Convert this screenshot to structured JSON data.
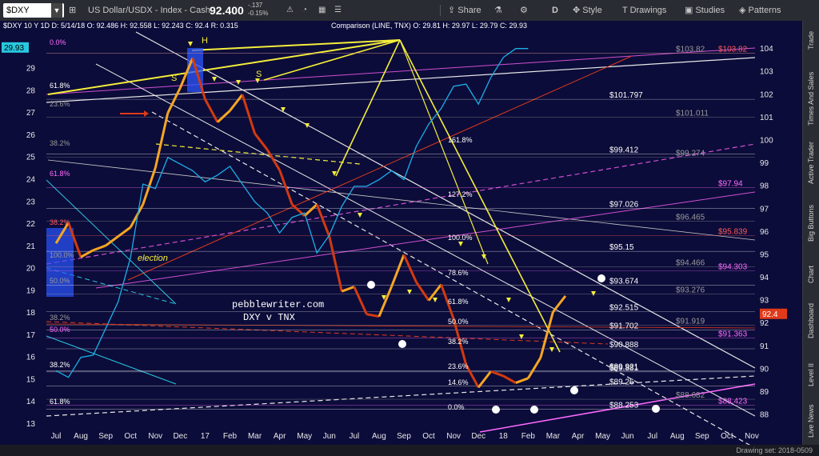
{
  "toolbar": {
    "symbol": "$DXY",
    "title": "US Dollar/USDX - Index - Cash",
    "last_price": "92.400",
    "change": "-.137",
    "change_pct": "-0.15%",
    "share": "Share",
    "interval": "D",
    "style": "Style",
    "drawings": "Drawings",
    "studies": "Studies",
    "patterns": "Patterns"
  },
  "legend": {
    "main": "$DXY 10 Y 1D  D: 5/14/18  O: 92.486  H: 92.558  L: 92.243  C: 92.4  R: 0.315",
    "comparison": "Comparison (LINE, TNX)  O: 29.81  H: 29.97  L: 29.79  C: 29.93"
  },
  "sidebar": [
    "Trade",
    "Times And Sales",
    "Active Trader",
    "Big Buttons",
    "Chart",
    "Dashboard",
    "Level II",
    "Live News"
  ],
  "status": "Drawing set: 2018-0509",
  "colors": {
    "bg": "#0c0c3a",
    "price_up": "#f5a623",
    "price_dn": "#d23a10",
    "tnx": "#1ab0e8",
    "yellow": "#f4ee3a",
    "magenta": "#d050d0",
    "white": "#e8e8e8",
    "red": "#e03a1a",
    "cyan": "#28c8e0"
  },
  "chart_data": {
    "type": "line",
    "title": "DXY v TNX",
    "watermark": "pebblewriter.com",
    "xlabels": [
      "Jul",
      "Aug",
      "Sep",
      "Oct",
      "Nov",
      "Dec",
      "17",
      "Feb",
      "Mar",
      "Apr",
      "May",
      "Jun",
      "Jul",
      "Aug",
      "Sep",
      "Oct",
      "Nov",
      "Dec",
      "18",
      "Feb",
      "Mar",
      "Apr",
      "May",
      "Jun",
      "Jul",
      "Aug",
      "Sep",
      "Oct",
      "Nov"
    ],
    "right_axis": {
      "label": "DXY",
      "min": 87.6,
      "max": 104.6,
      "ticks": [
        88,
        89,
        90,
        91,
        92,
        93,
        94,
        95,
        96,
        97,
        98,
        99,
        100,
        101,
        102,
        103,
        104
      ],
      "current": "92.4"
    },
    "left_axis": {
      "label": "TNX",
      "min": 13,
      "max": 30.5,
      "ticks": [
        13,
        14,
        15,
        16,
        17,
        18,
        19,
        20,
        21,
        22,
        23,
        24,
        25,
        26,
        27,
        28,
        29
      ],
      "current": "29.93"
    },
    "series": [
      {
        "name": "$DXY",
        "x": [
          0,
          0.5,
          1,
          1.5,
          2,
          2.5,
          3,
          3.5,
          4,
          4.5,
          5,
          5.5,
          6,
          6.5,
          7,
          7.5,
          8,
          8.5,
          9,
          9.5,
          10,
          10.5,
          11,
          11.5,
          12,
          12.5,
          13,
          13.5,
          14,
          14.5,
          15,
          15.5,
          16,
          16.5,
          17,
          17.5,
          18,
          18.5,
          19,
          19.5,
          20,
          20.5,
          21,
          21.5,
          22,
          22.5
        ],
        "values": [
          95.5,
          96.4,
          94.9,
          95.2,
          95.4,
          95.8,
          96.2,
          97.2,
          98.8,
          101.2,
          102.3,
          103.6,
          101.8,
          100.8,
          101.3,
          102.0,
          100.3,
          99.6,
          98.7,
          97.2,
          96.7,
          97.2,
          95.8,
          93.4,
          93.6,
          92.4,
          92.3,
          93.6,
          95.0,
          93.8,
          93.0,
          93.7,
          92.2,
          90.2,
          89.2,
          89.9,
          89.7,
          89.4,
          89.6,
          90.5,
          92.5,
          93.2,
          null,
          null,
          null,
          null
        ]
      },
      {
        "name": "TNX",
        "x": [
          0,
          0.5,
          1,
          1.5,
          2,
          2.5,
          3,
          3.5,
          4,
          4.5,
          5,
          5.5,
          6,
          6.5,
          7,
          7.5,
          8,
          8.5,
          9,
          9.5,
          10,
          10.5,
          11,
          11.5,
          12,
          12.5,
          13,
          13.5,
          14,
          14.5,
          15,
          15.5,
          16,
          16.5,
          17,
          17.5,
          18,
          18.5,
          19,
          19.5,
          20,
          20.5,
          21,
          21.5
        ],
        "values": [
          15.4,
          15.1,
          16.0,
          16.1,
          17.3,
          18.5,
          20.5,
          23.8,
          23.6,
          25.0,
          24.7,
          24.4,
          23.9,
          24.2,
          24.6,
          23.8,
          23.0,
          22.5,
          21.6,
          22.3,
          22.5,
          20.7,
          21.5,
          22.8,
          23.7,
          23.7,
          24.0,
          24.4,
          24.0,
          25.5,
          26.5,
          27.2,
          28.2,
          28.3,
          27.4,
          28.6,
          29.5,
          29.9,
          29.9,
          null,
          null,
          null,
          null,
          null
        ]
      }
    ],
    "annotations": [
      "H",
      "S",
      "S",
      "election",
      "0.0%",
      "61.8%",
      "23.6%",
      "38.2%",
      "61.8%",
      "50.0%",
      "38.2%",
      "50.0%",
      "38.2%",
      "100.0%",
      "38.2%",
      "61.8%",
      "161.8%",
      "127.2%",
      "100.0%",
      "78.6%",
      "61.8%",
      "50.0%",
      "38.2%",
      "23.6%",
      "14.6%",
      "0.0%"
    ],
    "price_levels": [
      {
        "value": 103.82,
        "label": "$103.82",
        "color": "#ff5a5a"
      },
      {
        "value": 103.82,
        "label": "$103.82",
        "color": "#9a9a9a"
      },
      {
        "value": 101.797,
        "label": "$101.797",
        "color": "#ffffff"
      },
      {
        "value": 101.011,
        "label": "$101.011",
        "color": "#9a9a9a"
      },
      {
        "value": 99.412,
        "label": "$99.412",
        "color": "#ffffff"
      },
      {
        "value": 99.274,
        "label": "$99.274",
        "color": "#9a9a9a"
      },
      {
        "value": 97.94,
        "label": "$97.94",
        "color": "#ff6aff"
      },
      {
        "value": 97.026,
        "label": "$97.026",
        "color": "#ffffff"
      },
      {
        "value": 96.465,
        "label": "$96.465",
        "color": "#9a9a9a"
      },
      {
        "value": 95.839,
        "label": "$95.839",
        "color": "#ff5a5a"
      },
      {
        "value": 95.15,
        "label": "$95.15",
        "color": "#ffffff"
      },
      {
        "value": 94.466,
        "label": "$94.466",
        "color": "#9a9a9a"
      },
      {
        "value": 94.303,
        "label": "$94.303",
        "color": "#ff6aff"
      },
      {
        "value": 93.674,
        "label": "$93.674",
        "color": "#ffffff"
      },
      {
        "value": 93.276,
        "label": "$93.276",
        "color": "#9a9a9a"
      },
      {
        "value": 92.515,
        "label": "$92.515",
        "color": "#ffffff"
      },
      {
        "value": 91.919,
        "label": "$91.919",
        "color": "#9a9a9a"
      },
      {
        "value": 91.702,
        "label": "$91.702",
        "color": "#ffffff"
      },
      {
        "value": 91.363,
        "label": "$91.363",
        "color": "#ff6aff"
      },
      {
        "value": 90.888,
        "label": "$90.888",
        "color": "#ffffff"
      },
      {
        "value": 89.921,
        "label": "$89.921",
        "color": "#ffffff"
      },
      {
        "value": 89.881,
        "label": "$89.881",
        "color": "#ffffff"
      },
      {
        "value": 89.26,
        "label": "$89.26",
        "color": "#ffffff"
      },
      {
        "value": 88.682,
        "label": "$88.682",
        "color": "#9a9a9a"
      },
      {
        "value": 88.423,
        "label": "$88.423",
        "color": "#ff6aff"
      },
      {
        "value": 88.253,
        "label": "$88.253",
        "color": "#ffffff"
      }
    ]
  }
}
